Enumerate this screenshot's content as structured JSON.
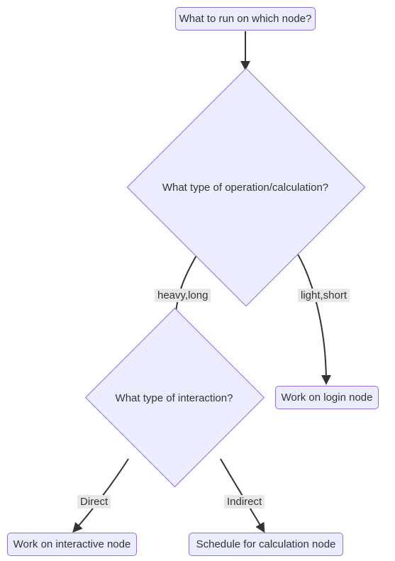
{
  "nodes": {
    "start": "What to run on which node?",
    "decision1": "What type of operation/calculation?",
    "decision2": "What type of interaction?",
    "login": "Work on login node",
    "interactive": "Work on interactive node",
    "schedule": "Schedule for calculation node"
  },
  "edges": {
    "heavy": "heavy,long",
    "light": "light,short",
    "direct": "Direct",
    "indirect": "Indirect"
  }
}
